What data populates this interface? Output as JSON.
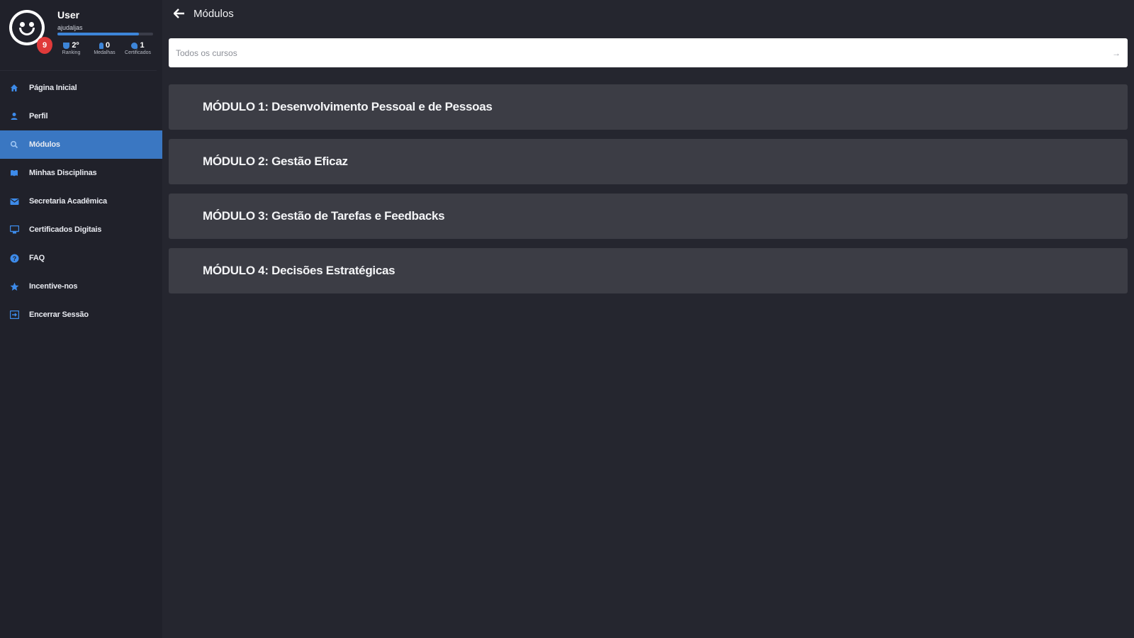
{
  "profile": {
    "name": "User",
    "subtitle": "ajudaljas",
    "level": "9",
    "xp_progress": 0.85,
    "stats": [
      {
        "value": "2º",
        "label": "Ranking",
        "icon": "trophy-icon"
      },
      {
        "value": "0",
        "label": "Medalhas",
        "icon": "medal-icon"
      },
      {
        "value": "1",
        "label": "Certificados",
        "icon": "certificate-icon"
      }
    ]
  },
  "nav": {
    "items": [
      {
        "label": "Página Inicial",
        "icon": "home-icon",
        "active": false
      },
      {
        "label": "Perfil",
        "icon": "user-icon",
        "active": false
      },
      {
        "label": "Módulos",
        "icon": "search-icon",
        "active": true
      },
      {
        "label": "Minhas Disciplinas",
        "icon": "book-icon",
        "active": false
      },
      {
        "label": "Secretaria Acadêmica",
        "icon": "mail-icon",
        "active": false
      },
      {
        "label": "Certificados Digitais",
        "icon": "certificate-icon",
        "active": false
      },
      {
        "label": "FAQ",
        "icon": "help-icon",
        "active": false
      },
      {
        "label": "Incentive-nos",
        "icon": "star-icon",
        "active": false
      },
      {
        "label": "Encerrar Sessão",
        "icon": "logout-icon",
        "active": false
      }
    ]
  },
  "header": {
    "title": "Módulos"
  },
  "search": {
    "placeholder": "Todos os cursos"
  },
  "modules": [
    {
      "title": "MÓDULO 1: Desenvolvimento Pessoal e de Pessoas"
    },
    {
      "title": "MÓDULO 2: Gestão Eficaz"
    },
    {
      "title": "MÓDULO 3: Gestão de Tarefas e Feedbacks"
    },
    {
      "title": "MÓDULO 4: Decisões Estratégicas"
    }
  ],
  "colors": {
    "background": "#25262f",
    "sidebar": "#20212a",
    "accent": "#3a77c2",
    "card": "#3c3d45",
    "badge": "#e03a3a"
  }
}
